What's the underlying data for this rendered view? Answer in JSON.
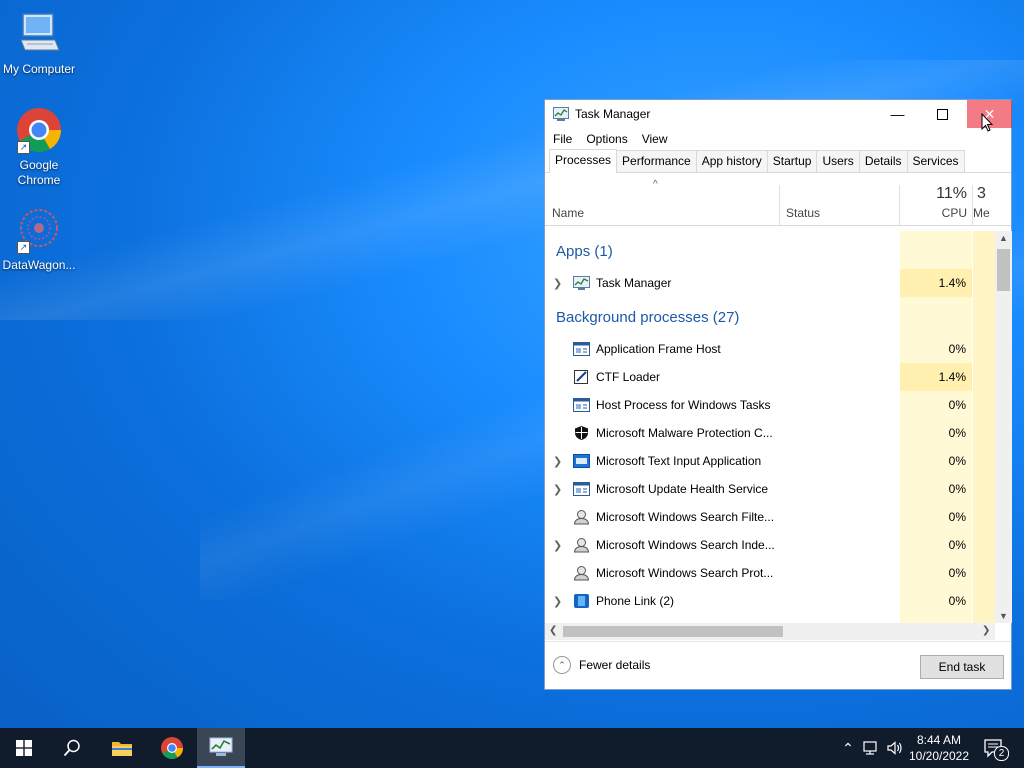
{
  "desktop": {
    "icons": [
      {
        "label": "My Computer"
      },
      {
        "label": "Google Chrome"
      },
      {
        "label": "DataWagon..."
      }
    ]
  },
  "task_manager": {
    "title": "Task Manager",
    "menu": [
      "File",
      "Options",
      "View"
    ],
    "tabs": [
      "Processes",
      "Performance",
      "App history",
      "Startup",
      "Users",
      "Details",
      "Services"
    ],
    "active_tab": "Processes",
    "columns": {
      "name": "Name",
      "status": "Status",
      "cpu_percent": "11%",
      "cpu_label": "CPU",
      "mem_percent": "3",
      "mem_label": "Me"
    },
    "groups": {
      "apps": "Apps (1)",
      "background": "Background processes (27)"
    },
    "apps": [
      {
        "name": "Task Manager",
        "cpu": "1.4%",
        "expandable": true
      }
    ],
    "background": [
      {
        "name": "Application Frame Host",
        "cpu": "0%",
        "expandable": false
      },
      {
        "name": "CTF Loader",
        "cpu": "1.4%",
        "expandable": false
      },
      {
        "name": "Host Process for Windows Tasks",
        "cpu": "0%",
        "expandable": false
      },
      {
        "name": "Microsoft Malware Protection C...",
        "cpu": "0%",
        "expandable": false
      },
      {
        "name": "Microsoft Text Input Application",
        "cpu": "0%",
        "expandable": true
      },
      {
        "name": "Microsoft Update Health Service",
        "cpu": "0%",
        "expandable": true
      },
      {
        "name": "Microsoft Windows Search Filte...",
        "cpu": "0%",
        "expandable": false
      },
      {
        "name": "Microsoft Windows Search Inde...",
        "cpu": "0%",
        "expandable": true
      },
      {
        "name": "Microsoft Windows Search Prot...",
        "cpu": "0%",
        "expandable": false
      },
      {
        "name": "Phone Link (2)",
        "cpu": "0%",
        "expandable": true
      }
    ],
    "footer": {
      "fewer_details": "Fewer details",
      "end_task": "End task"
    }
  },
  "taskbar": {
    "time": "8:44 AM",
    "date": "10/20/2022",
    "notification_count": "2"
  },
  "colors": {
    "accent": "#1c5aa8",
    "cpu_band": "#fff9d6",
    "close_hover": "#e81123",
    "taskbar": "#101b2b"
  }
}
